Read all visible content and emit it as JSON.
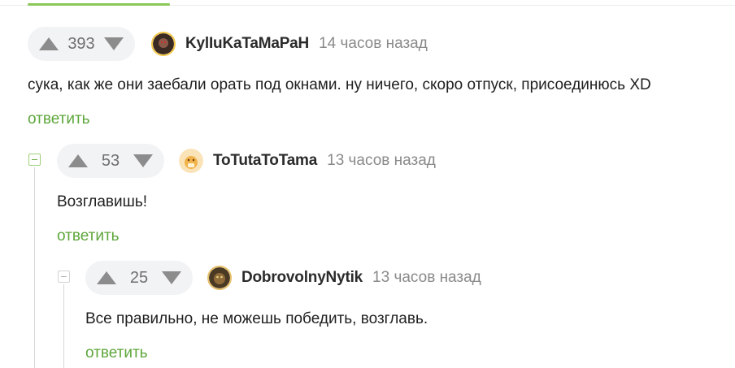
{
  "colors": {
    "accent": "#5ea63b",
    "vote_bg": "#f2f3f5",
    "muted": "#8a8a8a"
  },
  "icons": {
    "upvote": "triangle-up-icon",
    "downvote": "triangle-down-icon",
    "collapse": "minus-box-icon"
  },
  "comments": [
    {
      "votes": "393",
      "username": "KylIuKaTaMaPaH",
      "time": "14 часов назад",
      "text": "сука, как же они заебали орать под окнами. ну ничего, скоро отпуск, присоединюсь XD",
      "reply": "ответить"
    },
    {
      "votes": "53",
      "username": "ToTutaToTama",
      "time": "13 часов назад",
      "text": "Возглавишь!",
      "reply": "ответить"
    },
    {
      "votes": "25",
      "username": "DobrovolnyNytik",
      "time": "13 часов назад",
      "text": "Все правильно, не можешь победить, возглавь.",
      "reply": "ответить"
    }
  ]
}
